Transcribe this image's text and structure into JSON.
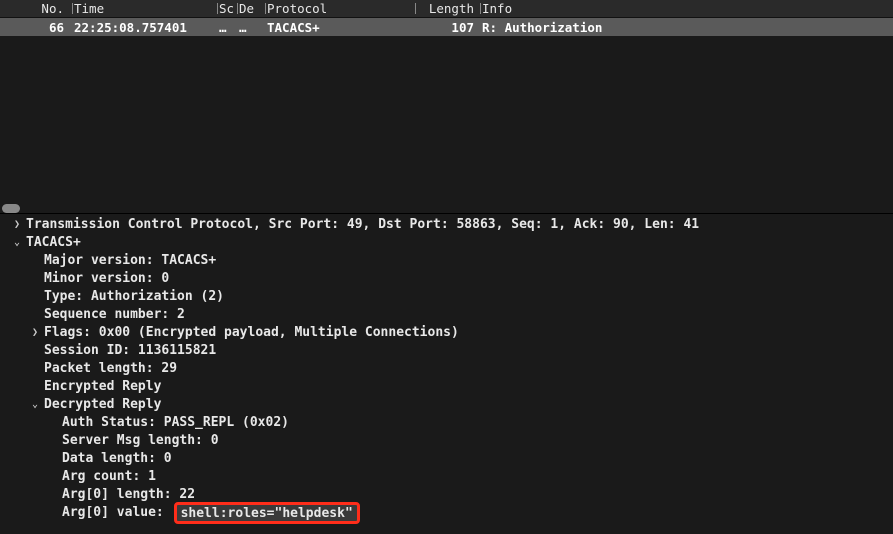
{
  "packet_list": {
    "headers": {
      "no": "No.",
      "time": "Time",
      "src": "Sc",
      "dst": "De",
      "proto": "Protocol",
      "len": "Length",
      "info": "Info"
    },
    "row": {
      "no": "66",
      "time": "22:25:08.757401",
      "src": "…",
      "dst": "…",
      "proto": "TACACS+",
      "len": "107",
      "info": "R: Authorization"
    }
  },
  "details": {
    "tcp_line": "Transmission Control Protocol, Src Port: 49, Dst Port: 58863, Seq: 1, Ack: 90, Len: 41",
    "tacacs_label": "TACACS+",
    "major_version": "Major version: TACACS+",
    "minor_version": "Minor version: 0",
    "type": "Type: Authorization (2)",
    "seq_num": "Sequence number: 2",
    "flags": "Flags: 0x00 (Encrypted payload, Multiple Connections)",
    "session_id": "Session ID: 1136115821",
    "packet_len": "Packet length: 29",
    "enc_reply": "Encrypted Reply",
    "dec_reply": "Decrypted Reply",
    "auth_status": "Auth Status: PASS_REPL (0x02)",
    "srv_msg_len": "Server Msg length: 0",
    "data_len": "Data length: 0",
    "arg_count": "Arg count: 1",
    "arg0_len": "Arg[0] length: 22",
    "arg0_val_label": "Arg[0] value: ",
    "arg0_val": "shell:roles=\"helpdesk\""
  }
}
